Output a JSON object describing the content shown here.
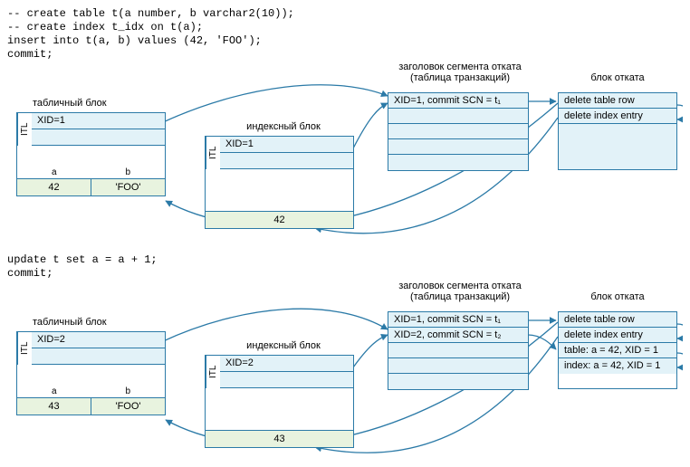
{
  "code": {
    "block1": "-- create table t(a number, b varchar2(10));\n-- create index t_idx on t(a);\ninsert into t(a, b) values (42, 'FOO');\ncommit;",
    "block2": "update t set a = a + 1;\ncommit;"
  },
  "labels": {
    "table_block": "табличный блок",
    "index_block": "индексный блок",
    "tx_header": "заголовок сегмента отката\n(таблица транзакций)",
    "undo_block": "блок отката",
    "itl": "ITL",
    "col_a": "a",
    "col_b": "b"
  },
  "scene1": {
    "table": {
      "xid": "XID=1",
      "a": "42",
      "b": "'FOO'"
    },
    "index": {
      "xid": "XID=1",
      "val": "42"
    },
    "tx_rows": [
      "XID=1, commit SCN = t₁",
      "",
      "",
      "",
      ""
    ],
    "undo_rows": [
      "delete table row",
      "delete index entry"
    ]
  },
  "scene2": {
    "table": {
      "xid": "XID=2",
      "a": "43",
      "b": "'FOO'"
    },
    "index": {
      "xid": "XID=2",
      "val": "43"
    },
    "tx_rows": [
      "XID=1, commit SCN = t₁",
      "XID=2, commit SCN = t₂",
      "",
      "",
      ""
    ],
    "undo_rows": [
      "delete table row",
      "delete index entry",
      "table: a = 42, XID = 1",
      "index: a = 42, XID = 1"
    ]
  },
  "chart_data": {
    "type": "table",
    "description": "Two-phase diagram showing Oracle block structures (table block, index block, rollback segment header with transaction table, and undo block) before and after an UPDATE.",
    "phases": [
      {
        "sql": [
          "-- create table t(a number, b varchar2(10));",
          "-- create index t_idx on t(a);",
          "insert into t(a, b) values (42, 'FOO');",
          "commit;"
        ],
        "table_block": {
          "itl": [
            {
              "xid": 1
            }
          ],
          "rows": [
            {
              "a": 42,
              "b": "FOO"
            }
          ]
        },
        "index_block": {
          "itl": [
            {
              "xid": 1
            }
          ],
          "entries": [
            42
          ]
        },
        "transaction_table": [
          {
            "xid": 1,
            "commit_scn": "t1"
          }
        ],
        "undo_block": [
          "delete table row",
          "delete index entry"
        ]
      },
      {
        "sql": [
          "update t set a = a + 1;",
          "commit;"
        ],
        "table_block": {
          "itl": [
            {
              "xid": 2
            }
          ],
          "rows": [
            {
              "a": 43,
              "b": "FOO"
            }
          ]
        },
        "index_block": {
          "itl": [
            {
              "xid": 2
            }
          ],
          "entries": [
            43
          ]
        },
        "transaction_table": [
          {
            "xid": 1,
            "commit_scn": "t1"
          },
          {
            "xid": 2,
            "commit_scn": "t2"
          }
        ],
        "undo_block": [
          "delete table row",
          "delete index entry",
          "table: a = 42, XID = 1",
          "index: a = 42, XID = 1"
        ]
      }
    ],
    "pointers": [
      "table_block.itl -> transaction_table",
      "index_block.itl -> transaction_table",
      "transaction_table -> undo_block",
      "undo_block -> table_block.row",
      "undo_block -> index_block.entry",
      "undo_block self-chain"
    ]
  }
}
